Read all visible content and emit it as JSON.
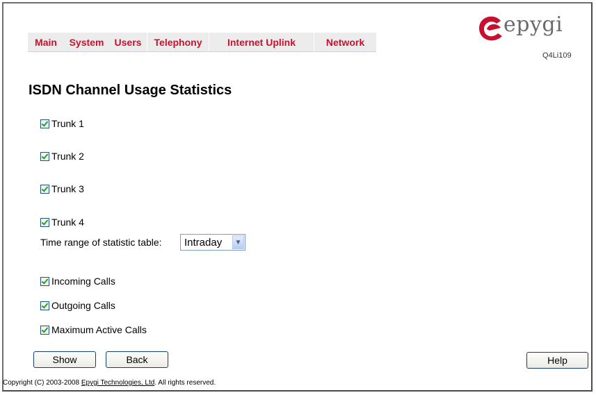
{
  "nav": {
    "items": [
      "Main",
      "System",
      "Users",
      "Telephony",
      "Internet Uplink",
      "Network"
    ]
  },
  "logo": {
    "brand": "epygi",
    "model": "Q4Li109"
  },
  "page_title": "ISDN Channel Usage Statistics",
  "trunks": [
    "Trunk 1",
    "Trunk 2",
    "Trunk 3",
    "Trunk 4"
  ],
  "time_range": {
    "label": "Time range of statistic table:",
    "selected": "Intraday"
  },
  "calls": [
    "Incoming Calls",
    "Outgoing Calls",
    "Maximum Active Calls"
  ],
  "buttons": {
    "show": "Show",
    "back": "Back",
    "help": "Help"
  },
  "footer": {
    "prefix": "Copyright (C) 2003-2008 ",
    "company": "Epygi Technologies, Ltd",
    "suffix": ". All rights reserved."
  },
  "colors": {
    "nav_text": "#c8102e",
    "logo_red": "#c8102e",
    "checkmark": "#21a121"
  }
}
